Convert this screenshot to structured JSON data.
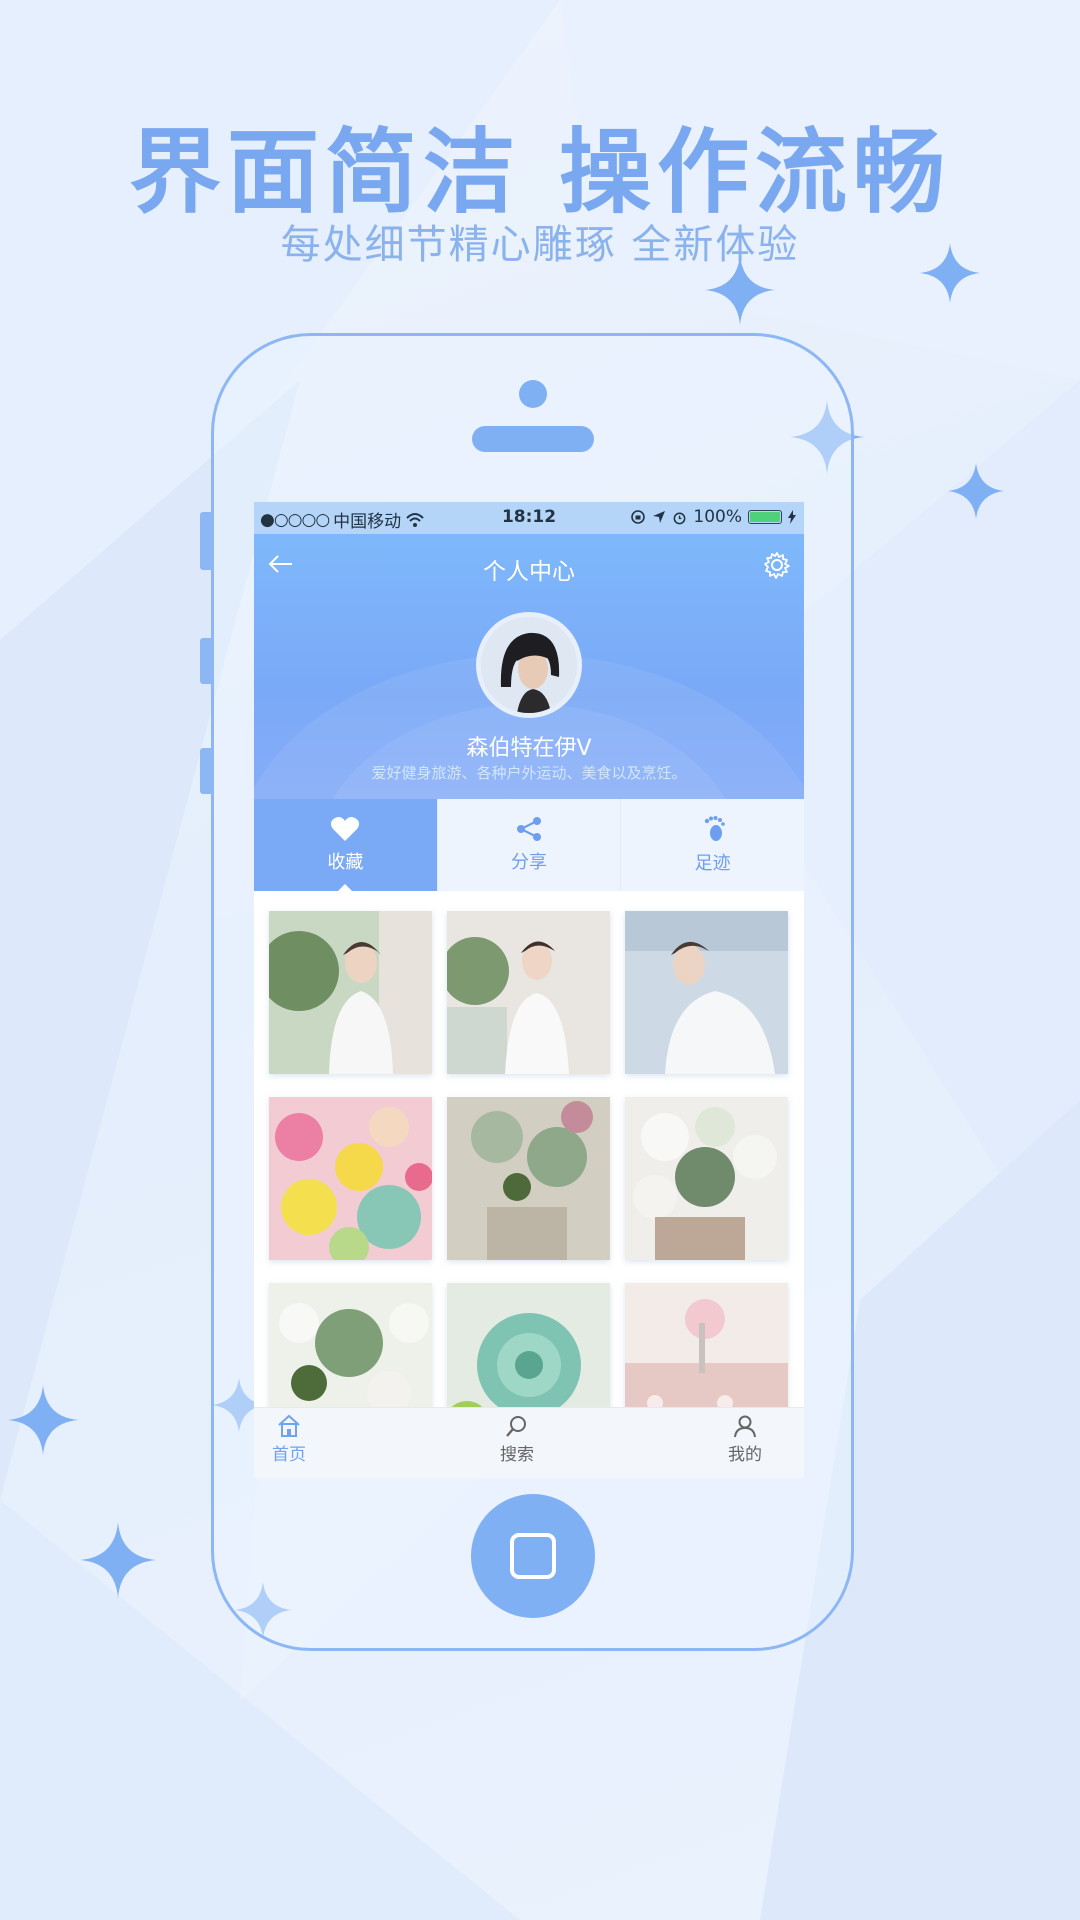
{
  "headline": "界面简洁 操作流畅",
  "subheadline": "每处细节精心雕琢  全新体验",
  "colors": {
    "accent": "#7aaaf5",
    "headline": "#79a8f1",
    "frame": "#8cb7f4"
  },
  "status_bar": {
    "carrier": "中国移动",
    "signal_dots": "●○○○○",
    "time": "18:12",
    "battery": "100%",
    "icons": [
      "wifi-icon",
      "rotation-lock-icon",
      "location-icon",
      "alarm-icon",
      "battery-icon",
      "charging-icon"
    ]
  },
  "header": {
    "title": "个人中心",
    "back_icon": "back-arrow-icon",
    "settings_icon": "gear-icon",
    "username": "森伯特在伊V",
    "bio": "爱好健身旅游、各种户外运动、美食以及烹饪。"
  },
  "tabs": [
    {
      "label": "收藏",
      "icon": "heart-icon",
      "active": true
    },
    {
      "label": "分享",
      "icon": "share-icon",
      "active": false
    },
    {
      "label": "足迹",
      "icon": "footprint-icon",
      "active": false
    }
  ],
  "bottom_nav": [
    {
      "label": "首页",
      "icon": "home-icon",
      "active": true
    },
    {
      "label": "搜索",
      "icon": "search-icon",
      "active": false
    },
    {
      "label": "我的",
      "icon": "profile-icon",
      "active": false
    }
  ]
}
